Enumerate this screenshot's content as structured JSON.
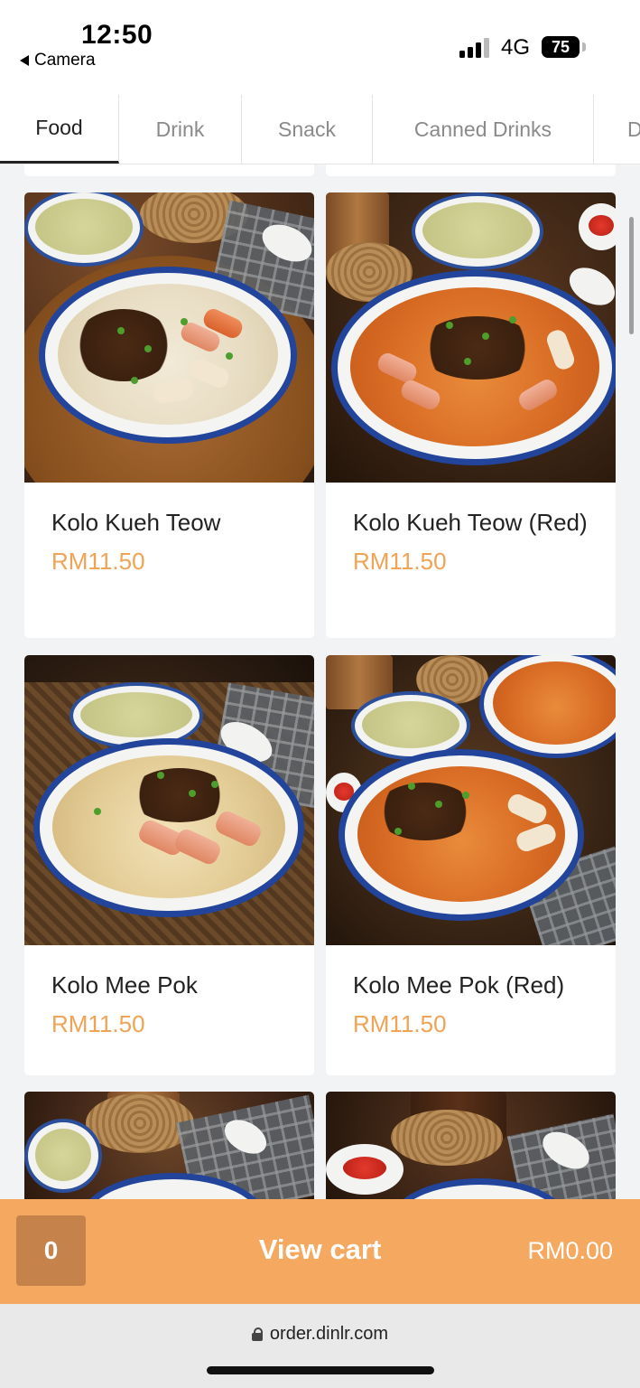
{
  "status_bar": {
    "time": "12:50",
    "back_app": "Camera",
    "network": "4G",
    "battery": "75"
  },
  "tabs": [
    {
      "label": "Food",
      "active": true
    },
    {
      "label": "Drink",
      "active": false
    },
    {
      "label": "Snack",
      "active": false
    },
    {
      "label": "Canned Drinks",
      "active": false
    },
    {
      "label": "D",
      "active": false
    }
  ],
  "menu_items": [
    {
      "name": "Kolo Kueh Teow",
      "price": "RM11.50"
    },
    {
      "name": "Kolo Kueh Teow (Red)",
      "price": "RM11.50"
    },
    {
      "name": "Kolo Mee Pok",
      "price": "RM11.50"
    },
    {
      "name": "Kolo Mee Pok (Red)",
      "price": "RM11.50"
    }
  ],
  "cart": {
    "count": "0",
    "label": "View cart",
    "total": "RM0.00"
  },
  "browser": {
    "url": "order.dinlr.com"
  },
  "colors": {
    "accent": "#f4a860",
    "price": "#f0a354",
    "cart_count_bg": "#c5824b"
  }
}
